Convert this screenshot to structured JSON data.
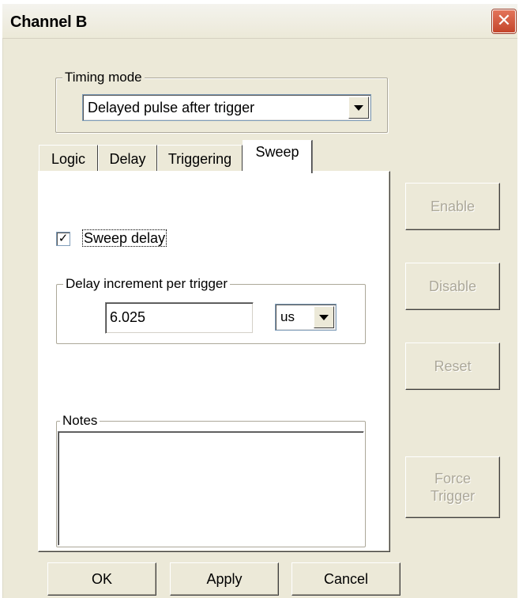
{
  "window": {
    "title": "Channel B",
    "close_glyph": "✕"
  },
  "timing_mode": {
    "legend": "Timing mode",
    "selected": "Delayed pulse after trigger"
  },
  "tabs": [
    {
      "label": "Logic"
    },
    {
      "label": "Delay"
    },
    {
      "label": "Triggering"
    },
    {
      "label": "Sweep"
    }
  ],
  "active_tab": "Sweep",
  "sweep": {
    "sweep_delay_label": "Sweep delay",
    "sweep_delay_checked": true,
    "check_glyph": "✓",
    "increment_legend": "Delay increment per trigger",
    "increment_value": "6.025",
    "unit_selected": "us",
    "notes_legend": "Notes",
    "notes_value": ""
  },
  "side_buttons": {
    "enable": "Enable",
    "disable": "Disable",
    "reset": "Reset",
    "force_trigger_line1": "Force",
    "force_trigger_line2": "Trigger"
  },
  "footer_buttons": {
    "ok": "OK",
    "apply": "Apply",
    "cancel": "Cancel"
  }
}
